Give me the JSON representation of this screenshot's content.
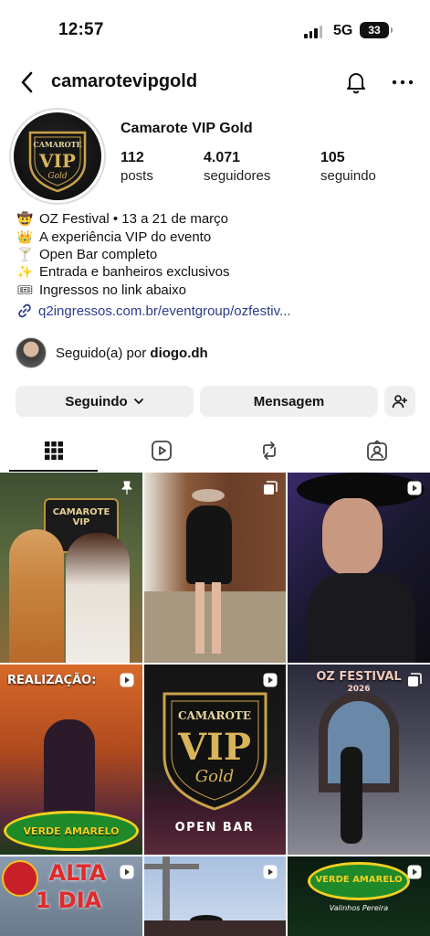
{
  "status_bar": {
    "time": "12:57",
    "network": "5G",
    "battery": "33"
  },
  "header": {
    "username": "camarotevipgold"
  },
  "profile": {
    "avatar_logo": {
      "top": "CAMAROTE",
      "main": "VIP",
      "sub": "Gold"
    },
    "name": "Camarote VIP Gold",
    "stats": [
      {
        "value": "112",
        "label": "posts"
      },
      {
        "value": "4.071",
        "label": "seguidores"
      },
      {
        "value": "105",
        "label": "seguindo"
      }
    ],
    "bio": [
      {
        "icon": "cowboy-hat-face-emoji",
        "glyph": "🤠",
        "text": "OZ Festival • 13 a 21 de março"
      },
      {
        "icon": "crown-emoji",
        "glyph": "👑",
        "text": "A experiência VIP do evento"
      },
      {
        "icon": "cocktail-emoji",
        "glyph": "🍸",
        "text": "Open Bar completo"
      },
      {
        "icon": "sparkles-emoji",
        "glyph": "✨",
        "text": "Entrada e banheiros exclusivos"
      },
      {
        "icon": "ticket-emoji",
        "glyph": "🎟",
        "text": "Ingressos no link abaixo"
      }
    ],
    "link": "q2ingressos.com.br/eventgroup/ozfestiv...",
    "followed_by": {
      "prefix": "Seguido(a) por",
      "user": "diogo.dh"
    }
  },
  "actions": {
    "following": "Seguindo",
    "message": "Mensagem"
  },
  "tabs": [
    "grid-icon",
    "reels-icon",
    "reposts-icon",
    "tagged-icon"
  ],
  "posts": [
    {
      "type": "pinned",
      "bg": "#4a5a3a",
      "text": "CAMAROTE VIP"
    },
    {
      "type": "carousel",
      "bg": "#5a3a2c",
      "text": ""
    },
    {
      "type": "reel",
      "bg": "#2a2440",
      "text": ""
    },
    {
      "type": "reel",
      "bg": "#b84a1c",
      "text": "REALIZAÇÃO:",
      "text2": "VERDE AMARELO"
    },
    {
      "type": "reel",
      "bg": "#141414",
      "text": "CAMAROTE",
      "text2": "VIP",
      "text3": "Gold",
      "text4": "OPEN BAR"
    },
    {
      "type": "carousel",
      "bg": "#3a3a48",
      "text": "OZ FESTIVAL",
      "text2": "2026"
    },
    {
      "type": "reel",
      "bg": "#8a9ab0",
      "text": "ALTA",
      "text2": "1 DIA"
    },
    {
      "type": "reel",
      "bg": "#9ab4d8",
      "text": ""
    },
    {
      "type": "reel",
      "bg": "#0a1a10",
      "text": "VERDE AMARELO",
      "text2": "Valinhos Pereira"
    }
  ]
}
